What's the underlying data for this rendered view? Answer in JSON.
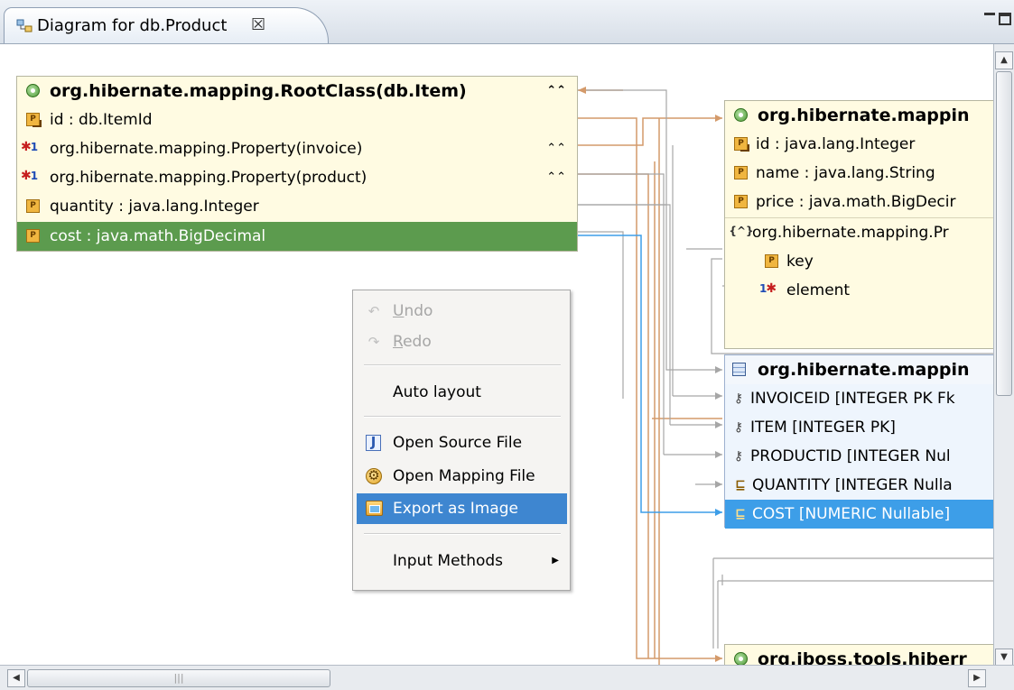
{
  "tab": {
    "title": "Diagram for db.Product",
    "close_glyph": "☒",
    "icon": "diagram-icon"
  },
  "window_controls": {
    "minimize": "minimize-icon",
    "maximize": "maximize-icon"
  },
  "item_entity": {
    "header": "org.hibernate.mapping.RootClass(db.Item)",
    "rows": [
      {
        "label": "id : db.ItemId",
        "icon": "id-property-icon"
      },
      {
        "label": "org.hibernate.mapping.Property(invoice)",
        "icon": "many-to-one-icon",
        "multiplicity": "*-1"
      },
      {
        "label": "org.hibernate.mapping.Property(product)",
        "icon": "many-to-one-icon",
        "multiplicity": "*-1"
      },
      {
        "label": "quantity : java.lang.Integer",
        "icon": "property-icon"
      },
      {
        "label": "cost : java.math.BigDecimal",
        "icon": "property-icon",
        "selected": true
      }
    ]
  },
  "product_entity": {
    "header": "org.hibernate.mappin",
    "rows": [
      {
        "label": "id : java.lang.Integer",
        "icon": "id-property-icon"
      },
      {
        "label": "name : java.lang.String",
        "icon": "property-icon"
      },
      {
        "label": "price : java.math.BigDecir",
        "icon": "property-icon"
      }
    ],
    "collection": {
      "label": "org.hibernate.mapping.Pr",
      "icon_text": "{^}",
      "rows": [
        {
          "label": "key",
          "icon": "property-icon"
        },
        {
          "label": "element",
          "icon": "one-to-many-icon",
          "multiplicity": "1-*"
        }
      ]
    }
  },
  "table_entity": {
    "header": "org.hibernate.mappin",
    "rows": [
      {
        "label": "INVOICEID [INTEGER PK Fk",
        "icon": "primary-foreign-key-icon"
      },
      {
        "label": "ITEM [INTEGER PK]",
        "icon": "primary-key-icon"
      },
      {
        "label": "PRODUCTID [INTEGER Nul",
        "icon": "primary-foreign-key-icon"
      },
      {
        "label": "QUANTITY [INTEGER Nulla",
        "icon": "column-icon"
      },
      {
        "label": "COST [NUMERIC Nullable]",
        "icon": "column-icon",
        "selected": true
      }
    ]
  },
  "bottom_entity": {
    "header": "org.jboss.tools.hiberr"
  },
  "context_menu": {
    "items": [
      {
        "label": "Undo",
        "mnemonic_underline": "U",
        "icon": "undo-icon",
        "enabled": false
      },
      {
        "label": "Redo",
        "mnemonic_underline": "R",
        "icon": "redo-icon",
        "enabled": false
      },
      {
        "label": "Auto layout",
        "enabled": true
      },
      {
        "label": "Open Source File",
        "icon": "java-source-icon",
        "enabled": true
      },
      {
        "label": "Open Mapping File",
        "icon": "mapping-file-icon",
        "enabled": true
      },
      {
        "label": "Export as Image",
        "icon": "export-image-icon",
        "enabled": true,
        "highlighted": true
      },
      {
        "label": "Input Methods",
        "enabled": true,
        "has_submenu": true
      }
    ]
  },
  "scrollbars": {
    "h_thumb_grip": "|||"
  },
  "colors": {
    "connection_orange": "#d49a6a",
    "connection_blue": "#3d9ee8",
    "selected_green": "#5c9b4e",
    "selected_blue": "#3d9ee8",
    "entity_bg": "#fffbe2",
    "menu_highlight": "#3e86d0"
  }
}
